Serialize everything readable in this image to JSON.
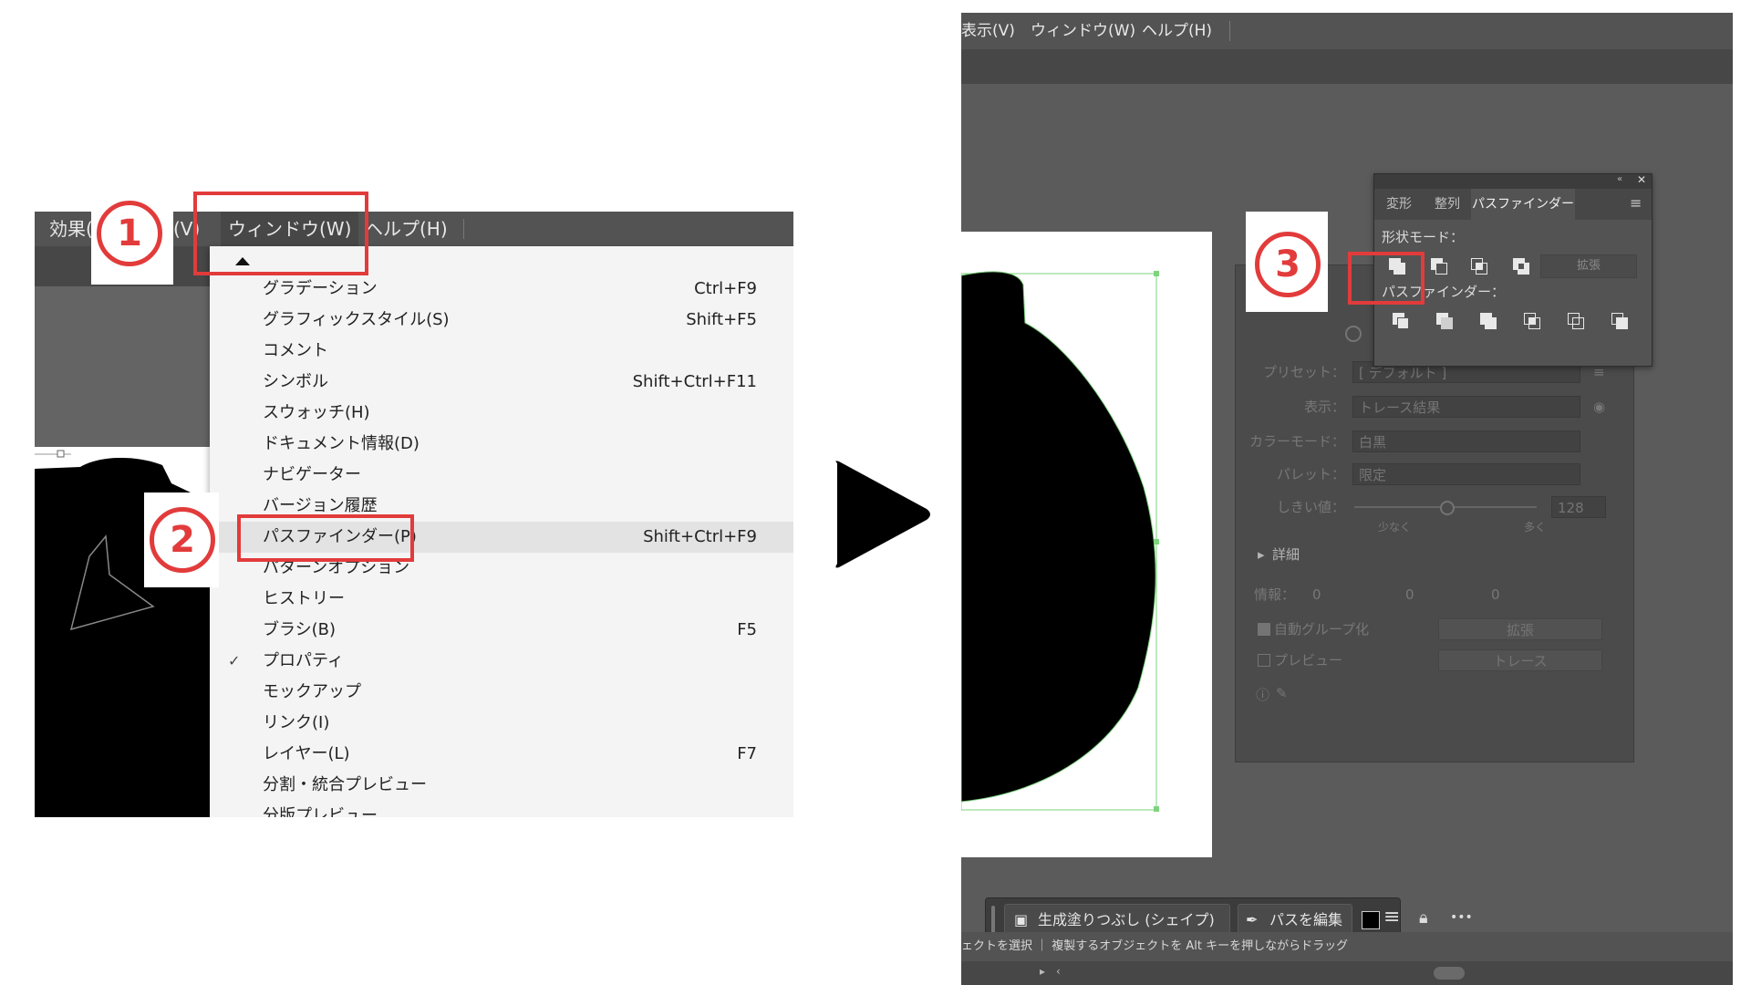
{
  "left_menubar": {
    "items": [
      "効果(",
      "(V)",
      "ウィンドウ(W)",
      "ヘルプ(H)"
    ]
  },
  "window_menu": {
    "items": [
      {
        "label": "グラデーション",
        "shortcut": "Ctrl+F9",
        "checked": false,
        "highlighted": false
      },
      {
        "label": "グラフィックスタイル(S)",
        "shortcut": "Shift+F5",
        "checked": false,
        "highlighted": false
      },
      {
        "label": "コメント",
        "shortcut": "",
        "checked": false,
        "highlighted": false
      },
      {
        "label": "シンボル",
        "shortcut": "Shift+Ctrl+F11",
        "checked": false,
        "highlighted": false
      },
      {
        "label": "スウォッチ(H)",
        "shortcut": "",
        "checked": false,
        "highlighted": false
      },
      {
        "label": "ドキュメント情報(D)",
        "shortcut": "",
        "checked": false,
        "highlighted": false
      },
      {
        "label": "ナビゲーター",
        "shortcut": "",
        "checked": false,
        "highlighted": false
      },
      {
        "label": "バージョン履歴",
        "shortcut": "",
        "checked": false,
        "highlighted": false
      },
      {
        "label": "パスファインダー(P)",
        "shortcut": "Shift+Ctrl+F9",
        "checked": false,
        "highlighted": true
      },
      {
        "label": "パターンオプション",
        "shortcut": "",
        "checked": false,
        "highlighted": false
      },
      {
        "label": "ヒストリー",
        "shortcut": "",
        "checked": false,
        "highlighted": false
      },
      {
        "label": "ブラシ(B)",
        "shortcut": "F5",
        "checked": false,
        "highlighted": false
      },
      {
        "label": "プロパティ",
        "shortcut": "",
        "checked": true,
        "highlighted": false
      },
      {
        "label": "モックアップ",
        "shortcut": "",
        "checked": false,
        "highlighted": false
      },
      {
        "label": "リンク(I)",
        "shortcut": "",
        "checked": false,
        "highlighted": false
      },
      {
        "label": "レイヤー(L)",
        "shortcut": "F7",
        "checked": false,
        "highlighted": false
      },
      {
        "label": "分割・統合プレビュー",
        "shortcut": "",
        "checked": false,
        "highlighted": false
      },
      {
        "label": "分版プレビュー",
        "shortcut": "",
        "checked": false,
        "highlighted": false
      }
    ],
    "check_glyph": "✓"
  },
  "steps": {
    "one": "1",
    "two": "2",
    "three": "3"
  },
  "right_menubar": {
    "items": [
      "表示(V)",
      "ウィンドウ(W)",
      "ヘルプ(H)"
    ]
  },
  "pathfinder_panel": {
    "tabs": [
      "変形",
      "整列",
      "パスファインダー"
    ],
    "active_tab": "パスファインダー",
    "shape_modes_label": "形状モード：",
    "expand_label": "拡張",
    "pathfinders_label": "パスファインダー：",
    "icons": [
      "unite-icon",
      "minus-front-icon",
      "intersect-icon",
      "exclude-icon",
      "divide-icon",
      "trim-icon",
      "merge-icon",
      "crop-icon",
      "outline-icon",
      "minus-back-icon"
    ]
  },
  "trace_panel": {
    "preset_label": "プリセット：",
    "preset_value": "[ デフォルト ]",
    "view_label": "表示：",
    "view_value": "トレース結果",
    "color_mode_label": "カラーモード：",
    "color_mode_value": "白黒",
    "palette_label": "パレット：",
    "palette_value": "限定",
    "threshold_label": "しきい値：",
    "threshold_value": "128",
    "less_label": "少なく",
    "more_label": "多く",
    "details_label": "詳細",
    "info_label": "情報：",
    "info_values": [
      "0",
      "0",
      "0"
    ],
    "auto_group_label": "自動グループ化",
    "expand_button": "拡張",
    "preview_label": "プレビュー",
    "trace_button": "トレース"
  },
  "context_toolbar": {
    "generative_fill": "生成塗りつぶし (シェイプ)",
    "edit_path": "パスを編集",
    "more_glyph": "•••"
  },
  "status_bar": {
    "text": "ェクトを選択 ｜ 複製するオブジェクトを Alt キーを押しながらドラッグ"
  },
  "colors": {
    "highlight_red": "#e23b3b",
    "menubar": "#535353",
    "workspace": "#5b5b5b",
    "selection_green": "#7ed37e"
  }
}
